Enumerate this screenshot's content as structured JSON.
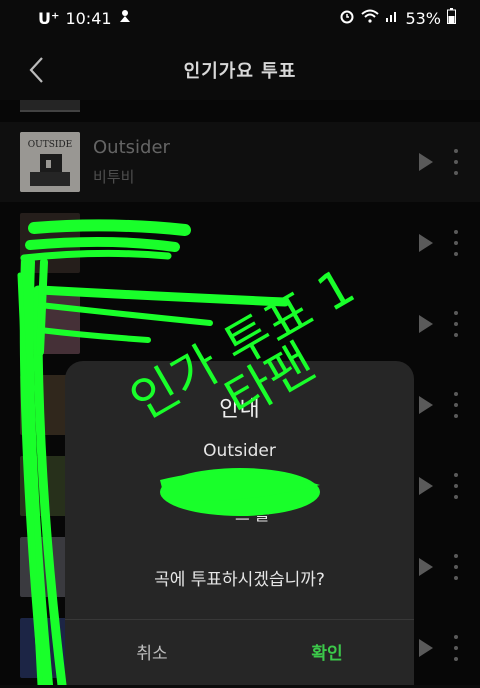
{
  "status_bar": {
    "carrier": "U⁺",
    "time": "10:41",
    "battery": "53%",
    "left_icon": "notification-icon",
    "right_icons": [
      "alarm-icon",
      "wifi-icon",
      "signal-icon",
      "battery-icon"
    ]
  },
  "header": {
    "title": "인기가요 투표",
    "back_icon": "back-chevron-icon"
  },
  "songs": [
    {
      "title": "Outsider",
      "artist": "비투비",
      "highlighted": true
    }
  ],
  "dialog": {
    "title": "안내",
    "song": "Outsider",
    "artist_partial": "트 를",
    "question": "곡에 투표하시겠습니까?",
    "cancel_label": "취소",
    "confirm_label": "확인"
  },
  "annotation": {
    "line1": "인가 투표 1",
    "line2": "타팬",
    "color": "#19ff2a"
  },
  "colors": {
    "accent": "#3cc94a",
    "background": "#0b0b0b",
    "dialog": "#262626"
  }
}
